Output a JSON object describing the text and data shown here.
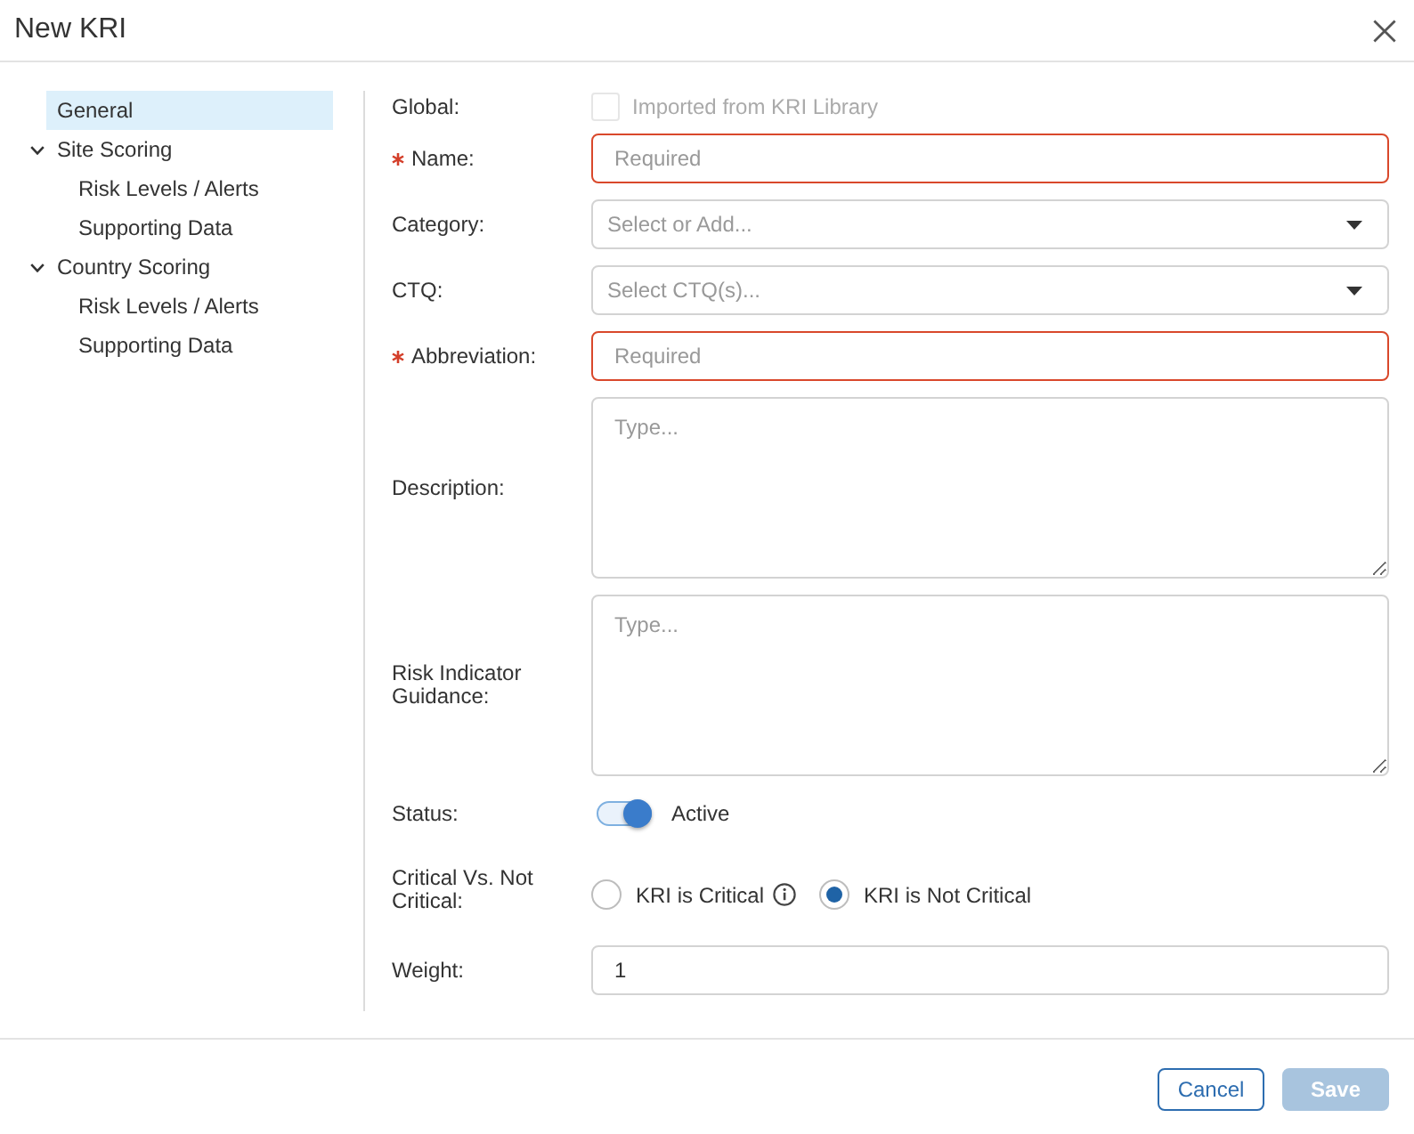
{
  "dialog": {
    "title": "New KRI"
  },
  "sidebar": {
    "items": [
      {
        "label": "General",
        "selected": true
      },
      {
        "label": "Site Scoring",
        "selected": false,
        "expanded": true,
        "children": [
          {
            "label": "Risk Levels / Alerts",
            "selected": false
          },
          {
            "label": "Supporting Data",
            "selected": false
          }
        ]
      },
      {
        "label": "Country Scoring",
        "selected": false,
        "expanded": true,
        "children": [
          {
            "label": "Risk Levels / Alerts",
            "selected": false
          },
          {
            "label": "Supporting Data",
            "selected": false
          }
        ]
      }
    ]
  },
  "form": {
    "fields": [
      {
        "kind": "checkbox",
        "label": "Global:",
        "required": false,
        "text": "Imported from KRI Library",
        "checked": false,
        "disabled": true
      },
      {
        "kind": "text",
        "label": "Name:",
        "required": true,
        "placeholder": "Required"
      },
      {
        "kind": "select",
        "label": "Category:",
        "required": false,
        "placeholder": "Select or Add..."
      },
      {
        "kind": "select",
        "label": "CTQ:",
        "required": false,
        "placeholder": "Select CTQ(s)..."
      },
      {
        "kind": "text",
        "label": "Abbreviation:",
        "required": true,
        "placeholder": "Required"
      },
      {
        "kind": "textarea",
        "label": "Description:",
        "required": false,
        "placeholder": "Type..."
      },
      {
        "kind": "textarea",
        "label": "Risk Indicator Guidance:",
        "required": false,
        "placeholder": "Type..."
      },
      {
        "kind": "toggle",
        "label": "Status:",
        "required": false,
        "on": true,
        "text": "Active"
      },
      {
        "kind": "radio",
        "label": "Critical Vs. Not Critical:",
        "required": false,
        "options": [
          {
            "label": "KRI is Critical",
            "selected": false,
            "info": true
          },
          {
            "label": "KRI is Not Critical",
            "selected": true,
            "info": false
          }
        ]
      },
      {
        "kind": "text",
        "label": "Weight:",
        "required": false,
        "value": "1"
      }
    ]
  },
  "buttons": [
    {
      "label": "Cancel",
      "kind": "secondary",
      "disabled": false
    },
    {
      "label": "Save",
      "kind": "primary",
      "disabled": true
    }
  ]
}
